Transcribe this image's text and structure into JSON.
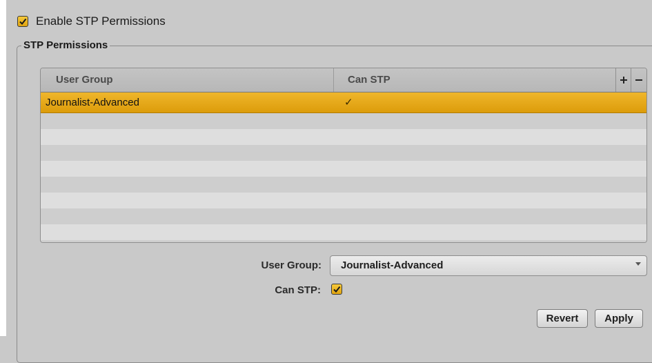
{
  "enable": {
    "label": "Enable STP Permissions",
    "checked": true
  },
  "group": {
    "title": "STP Permissions"
  },
  "table": {
    "columns": [
      "User Group",
      "Can STP"
    ],
    "add_label": "+",
    "remove_label": "−",
    "rows": [
      {
        "user_group": "Journalist-Advanced",
        "can_stp": "✓",
        "selected": true
      }
    ]
  },
  "form": {
    "user_group_label": "User Group:",
    "user_group_value": "Journalist-Advanced",
    "can_stp_label": "Can STP:",
    "can_stp_checked": true
  },
  "buttons": {
    "revert": "Revert",
    "apply": "Apply"
  },
  "colors": {
    "accent": "#e8a91c",
    "panel_bg": "#c9c9c9",
    "row_alt_a": "#cecece",
    "row_alt_b": "#dedede"
  }
}
